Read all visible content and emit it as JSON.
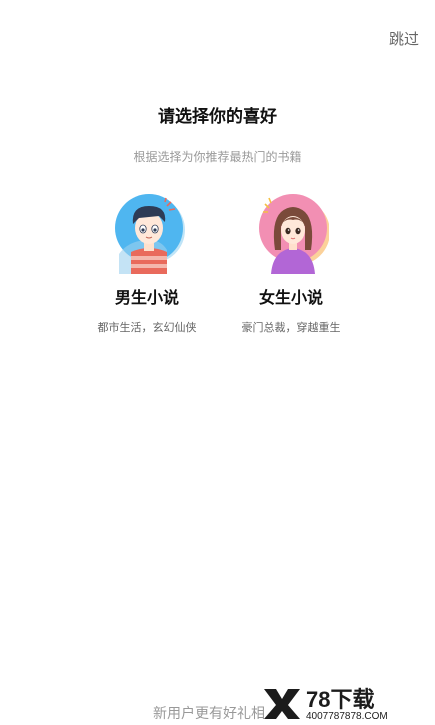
{
  "header": {
    "skip_label": "跳过"
  },
  "main": {
    "title": "请选择你的喜好",
    "subtitle": "根据选择为你推荐最热门的书籍",
    "choices": [
      {
        "label": "男生小说",
        "desc": "都市生活，玄幻仙侠",
        "icon": "boy-avatar-icon"
      },
      {
        "label": "女生小说",
        "desc": "豪门总裁，穿越重生",
        "icon": "girl-avatar-icon"
      }
    ]
  },
  "footer": {
    "promo_text": "新用户更有好礼相"
  },
  "watermark": {
    "brand": "78下载",
    "site": "4007787878.COM"
  },
  "colors": {
    "male_bg": "#4fb6f0",
    "female_bg": "#f28fb3",
    "title": "#111111",
    "muted": "#999999"
  }
}
